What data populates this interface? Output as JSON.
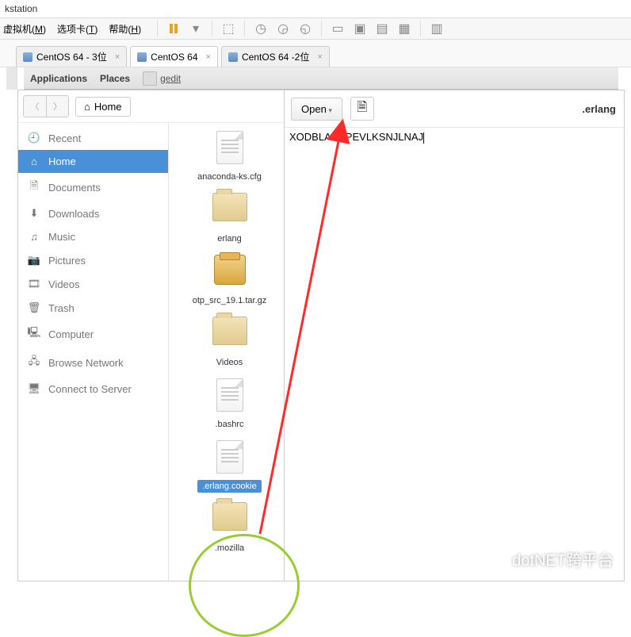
{
  "window_title": "kstation",
  "vm_menu": {
    "vm": "虚拟机",
    "vm_key": "M",
    "tabs": "选项卡",
    "tabs_key": "T",
    "help": "帮助",
    "help_key": "H"
  },
  "vm_tabs": [
    {
      "label": "CentOS 64 - 3位",
      "active": false
    },
    {
      "label": "CentOS 64",
      "active": true
    },
    {
      "label": "CentOS 64  -2位",
      "active": false
    }
  ],
  "gnome": {
    "applications": "Applications",
    "places": "Places",
    "app": "gedit"
  },
  "files": {
    "home_label": "Home",
    "sidebar": [
      {
        "label": "Recent",
        "icon": "🕘"
      },
      {
        "label": "Home",
        "icon": "⌂",
        "active": true
      },
      {
        "label": "Documents",
        "icon": "🗎"
      },
      {
        "label": "Downloads",
        "icon": "⬇"
      },
      {
        "label": "Music",
        "icon": "♫"
      },
      {
        "label": "Pictures",
        "icon": "📷"
      },
      {
        "label": "Videos",
        "icon": "🎞"
      },
      {
        "label": "Trash",
        "icon": "🗑"
      },
      {
        "label": "Computer",
        "icon": "🖳"
      },
      {
        "label": "Browse Network",
        "icon": "🖧"
      },
      {
        "label": "Connect to Server",
        "icon": "🖥"
      }
    ],
    "items": [
      {
        "label": "anaconda-ks.cfg",
        "type": "file"
      },
      {
        "label": "erlang",
        "type": "folder"
      },
      {
        "label": "otp_src_19.1.tar.gz",
        "type": "archive"
      },
      {
        "label": "Videos",
        "type": "folder"
      },
      {
        "label": ".bashrc",
        "type": "file"
      },
      {
        "label": ".erlang.cookie",
        "type": "file",
        "selected": true
      },
      {
        "label": ".mozilla",
        "type": "folder"
      }
    ]
  },
  "gedit": {
    "open": "Open",
    "title": ".erlang",
    "content": "XODBLADBPEVLKSNJLNAJ"
  },
  "watermark": "dotNET跨平台"
}
